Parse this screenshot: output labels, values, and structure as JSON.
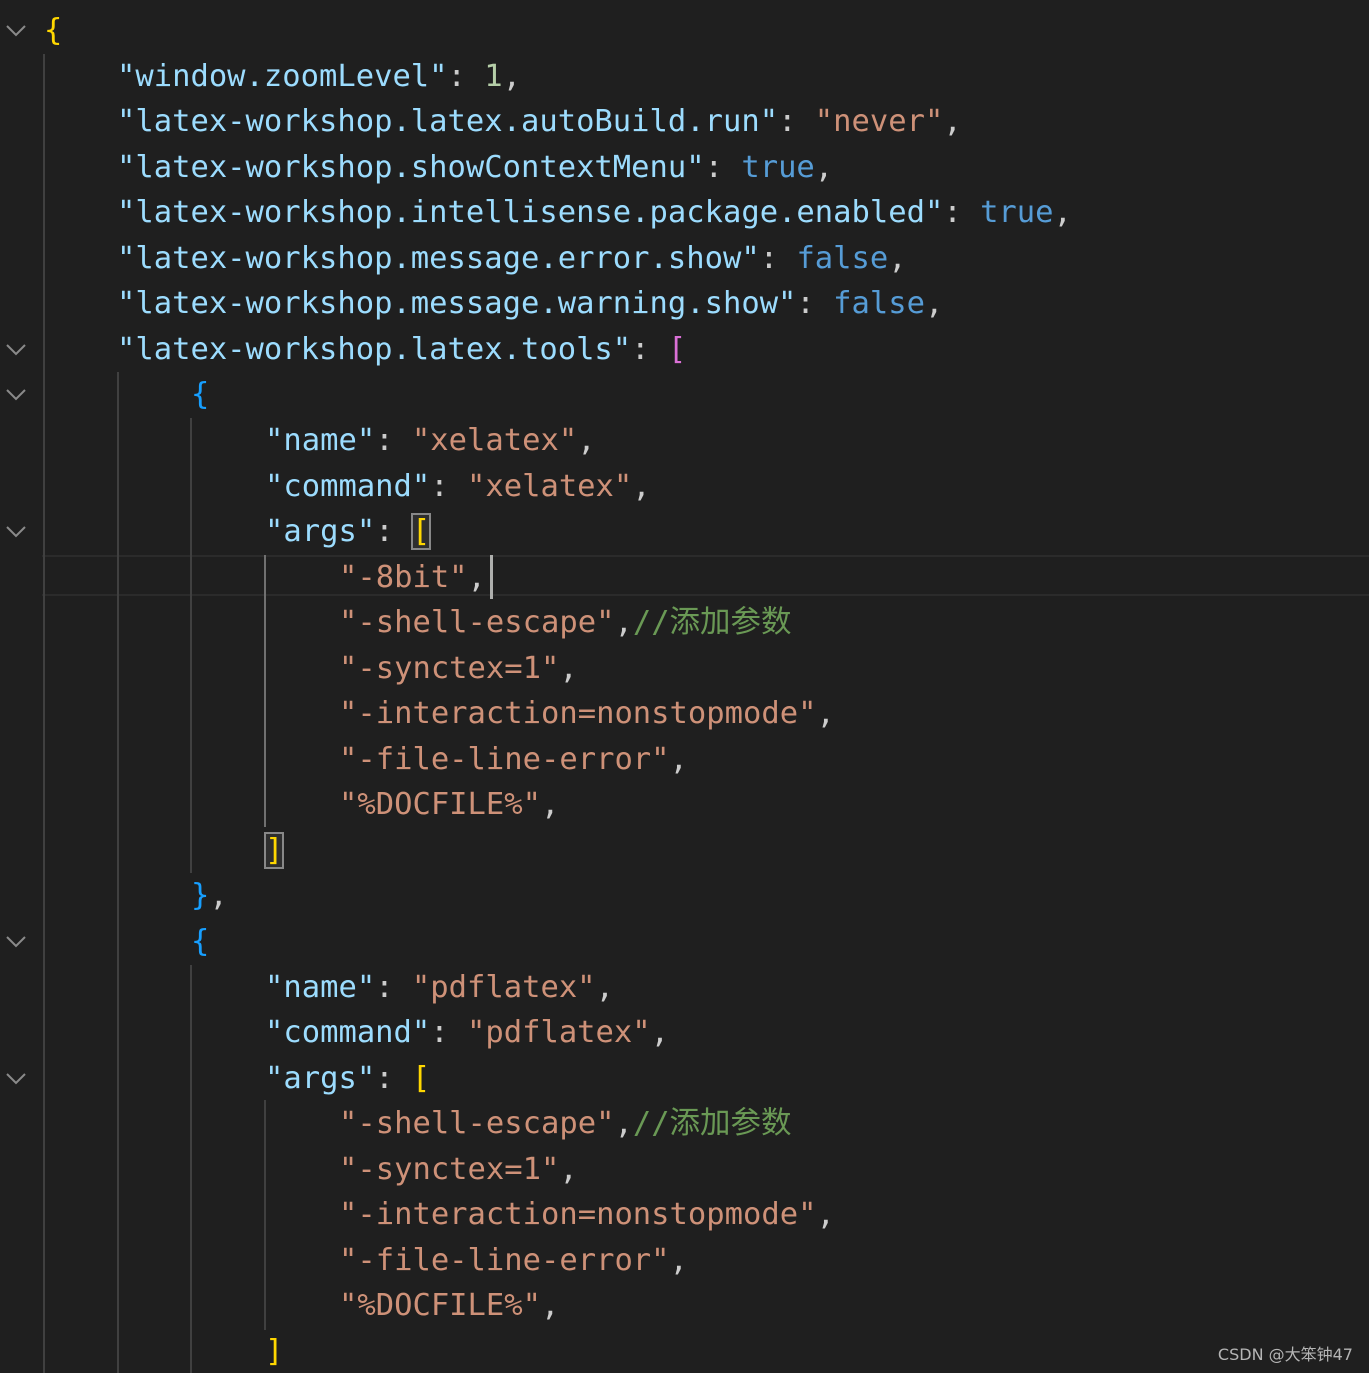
{
  "editor": {
    "watermark": "CSDN @大笨钟47",
    "lines": [
      {
        "tokens": [
          {
            "t": "{",
            "c": "br-gold"
          }
        ]
      },
      {
        "tokens": [
          {
            "t": "\"window.zoomLevel\"",
            "c": "k"
          },
          {
            "t": ": ",
            "c": "p"
          },
          {
            "t": "1",
            "c": "n"
          },
          {
            "t": ",",
            "c": "p"
          }
        ]
      },
      {
        "tokens": [
          {
            "t": "\"latex-workshop.latex.autoBuild.run\"",
            "c": "k"
          },
          {
            "t": ": ",
            "c": "p"
          },
          {
            "t": "\"never\"",
            "c": "s"
          },
          {
            "t": ",",
            "c": "p"
          }
        ]
      },
      {
        "tokens": [
          {
            "t": "\"latex-workshop.showContextMenu\"",
            "c": "k"
          },
          {
            "t": ": ",
            "c": "p"
          },
          {
            "t": "true",
            "c": "b"
          },
          {
            "t": ",",
            "c": "p"
          }
        ]
      },
      {
        "tokens": [
          {
            "t": "\"latex-workshop.intellisense.package.enabled\"",
            "c": "k"
          },
          {
            "t": ": ",
            "c": "p"
          },
          {
            "t": "true",
            "c": "b"
          },
          {
            "t": ",",
            "c": "p"
          }
        ]
      },
      {
        "tokens": [
          {
            "t": "\"latex-workshop.message.error.show\"",
            "c": "k"
          },
          {
            "t": ": ",
            "c": "p"
          },
          {
            "t": "false",
            "c": "b"
          },
          {
            "t": ",",
            "c": "p"
          }
        ]
      },
      {
        "tokens": [
          {
            "t": "\"latex-workshop.message.warning.show\"",
            "c": "k"
          },
          {
            "t": ": ",
            "c": "p"
          },
          {
            "t": "false",
            "c": "b"
          },
          {
            "t": ",",
            "c": "p"
          }
        ]
      },
      {
        "tokens": [
          {
            "t": "\"latex-workshop.latex.tools\"",
            "c": "k"
          },
          {
            "t": ": ",
            "c": "p"
          },
          {
            "t": "[",
            "c": "br-pink"
          }
        ]
      },
      {
        "tokens": [
          {
            "t": "{",
            "c": "br-blue"
          }
        ]
      },
      {
        "tokens": [
          {
            "t": "\"name\"",
            "c": "k"
          },
          {
            "t": ": ",
            "c": "p"
          },
          {
            "t": "\"xelatex\"",
            "c": "s"
          },
          {
            "t": ",",
            "c": "p"
          }
        ]
      },
      {
        "tokens": [
          {
            "t": "\"command\"",
            "c": "k"
          },
          {
            "t": ": ",
            "c": "p"
          },
          {
            "t": "\"xelatex\"",
            "c": "s"
          },
          {
            "t": ",",
            "c": "p"
          }
        ]
      },
      {
        "tokens": [
          {
            "t": "\"args\"",
            "c": "k"
          },
          {
            "t": ": ",
            "c": "p"
          },
          {
            "t": "[",
            "c": "br-gold match"
          }
        ]
      },
      {
        "tokens": [
          {
            "t": "\"-8bit\"",
            "c": "s"
          },
          {
            "t": ",",
            "c": "p"
          }
        ],
        "cursor": true
      },
      {
        "tokens": [
          {
            "t": "\"-shell-escape\"",
            "c": "s"
          },
          {
            "t": ",",
            "c": "p"
          },
          {
            "t": "//添加参数",
            "c": "c"
          }
        ]
      },
      {
        "tokens": [
          {
            "t": "\"-synctex=1\"",
            "c": "s"
          },
          {
            "t": ",",
            "c": "p"
          }
        ]
      },
      {
        "tokens": [
          {
            "t": "\"-interaction=nonstopmode\"",
            "c": "s"
          },
          {
            "t": ",",
            "c": "p"
          }
        ]
      },
      {
        "tokens": [
          {
            "t": "\"-file-line-error\"",
            "c": "s"
          },
          {
            "t": ",",
            "c": "p"
          }
        ]
      },
      {
        "tokens": [
          {
            "t": "\"%DOCFILE%\"",
            "c": "s"
          },
          {
            "t": ",",
            "c": "p"
          }
        ]
      },
      {
        "tokens": [
          {
            "t": "]",
            "c": "br-gold match"
          }
        ]
      },
      {
        "tokens": [
          {
            "t": "}",
            "c": "br-blue"
          },
          {
            "t": ",",
            "c": "p"
          }
        ]
      },
      {
        "tokens": [
          {
            "t": "{",
            "c": "br-blue"
          }
        ]
      },
      {
        "tokens": [
          {
            "t": "\"name\"",
            "c": "k"
          },
          {
            "t": ": ",
            "c": "p"
          },
          {
            "t": "\"pdflatex\"",
            "c": "s"
          },
          {
            "t": ",",
            "c": "p"
          }
        ]
      },
      {
        "tokens": [
          {
            "t": "\"command\"",
            "c": "k"
          },
          {
            "t": ": ",
            "c": "p"
          },
          {
            "t": "\"pdflatex\"",
            "c": "s"
          },
          {
            "t": ",",
            "c": "p"
          }
        ]
      },
      {
        "tokens": [
          {
            "t": "\"args\"",
            "c": "k"
          },
          {
            "t": ": ",
            "c": "p"
          },
          {
            "t": "[",
            "c": "br-gold"
          }
        ]
      },
      {
        "tokens": [
          {
            "t": "\"-shell-escape\"",
            "c": "s"
          },
          {
            "t": ",",
            "c": "p"
          },
          {
            "t": "//添加参数",
            "c": "c"
          }
        ]
      },
      {
        "tokens": [
          {
            "t": "\"-synctex=1\"",
            "c": "s"
          },
          {
            "t": ",",
            "c": "p"
          }
        ]
      },
      {
        "tokens": [
          {
            "t": "\"-interaction=nonstopmode\"",
            "c": "s"
          },
          {
            "t": ",",
            "c": "p"
          }
        ]
      },
      {
        "tokens": [
          {
            "t": "\"-file-line-error\"",
            "c": "s"
          },
          {
            "t": ",",
            "c": "p"
          }
        ]
      },
      {
        "tokens": [
          {
            "t": "\"%DOCFILE%\"",
            "c": "s"
          },
          {
            "t": ",",
            "c": "p"
          }
        ]
      },
      {
        "tokens": [
          {
            "t": "]",
            "c": "br-gold"
          }
        ]
      }
    ]
  }
}
